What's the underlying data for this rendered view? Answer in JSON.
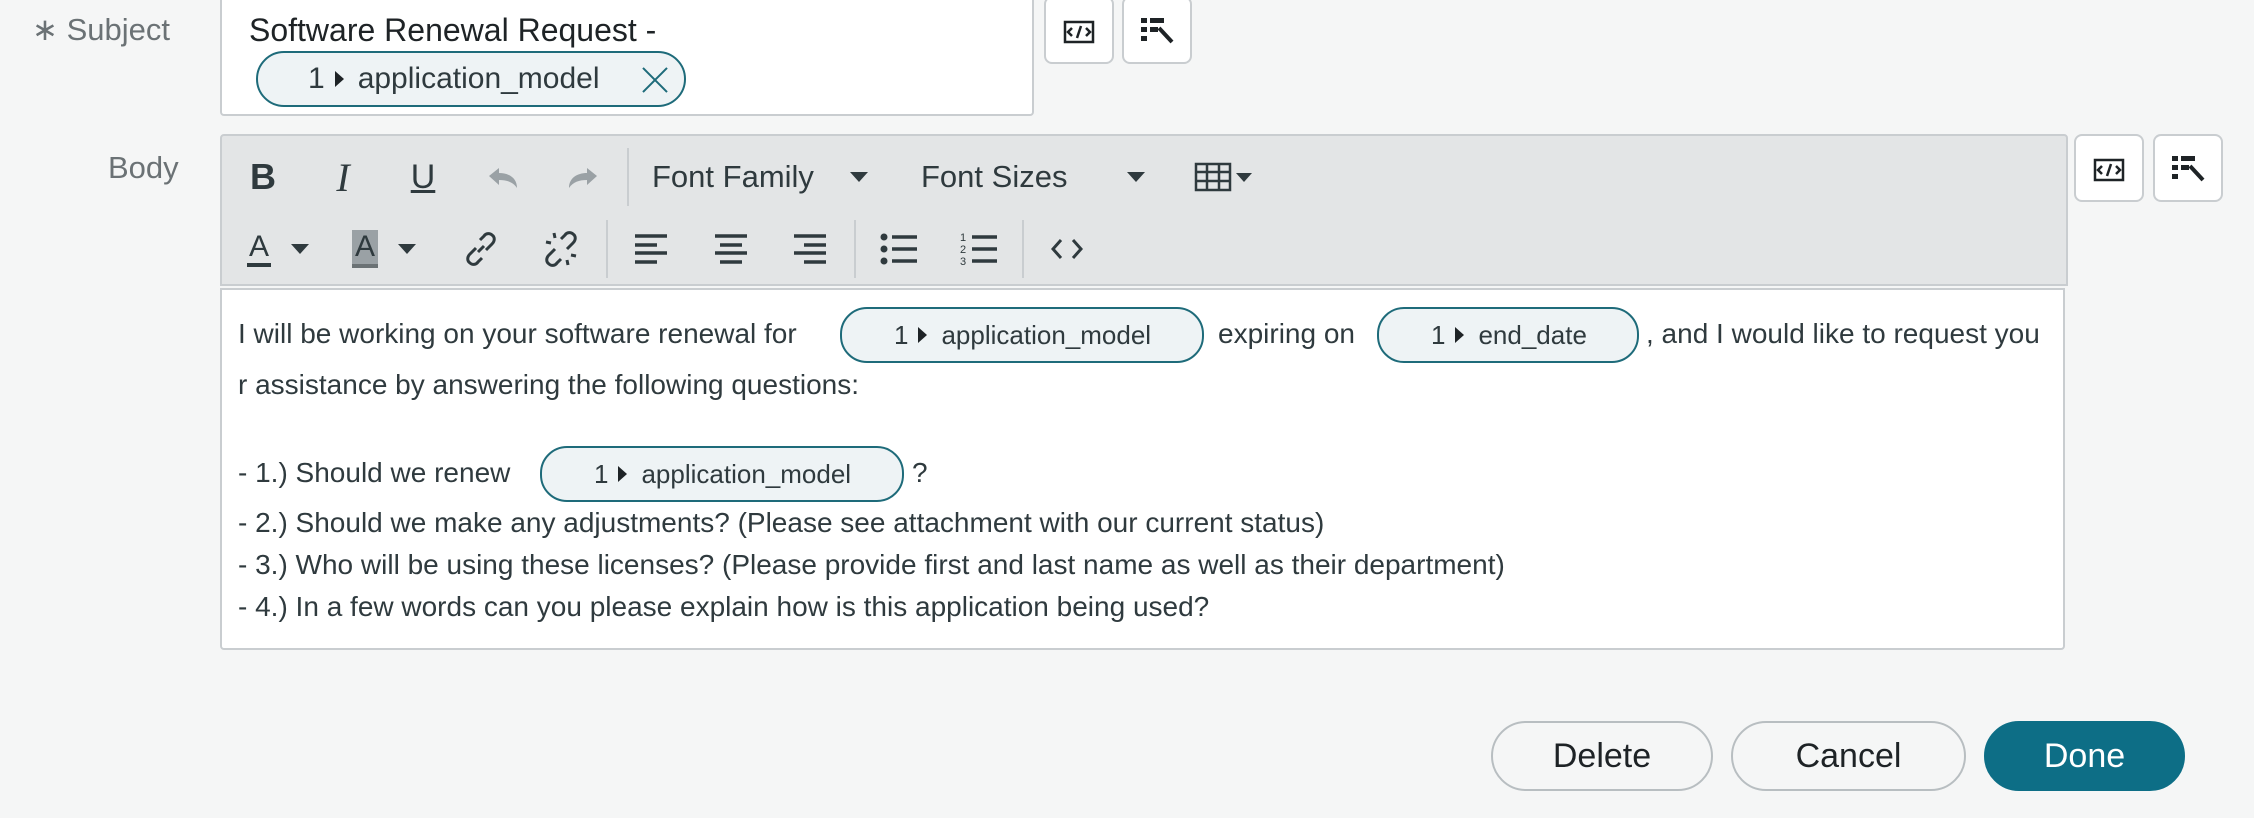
{
  "subject": {
    "label": "Subject",
    "required_marker": "∗",
    "text": "Software Renewal Request -",
    "token": {
      "index": "1",
      "field": "application_model"
    }
  },
  "body": {
    "label": "Body",
    "toolbar": {
      "font_family": "Font Family",
      "font_sizes": "Font Sizes",
      "bold": "B",
      "italic": "I",
      "underline": "U",
      "font_color": "A",
      "highlight_color": "A"
    },
    "content": {
      "line1_prefix": "I will be working on your software renewal for",
      "token1": {
        "index": "1",
        "field": "application_model"
      },
      "line1_mid": "expiring on",
      "token2": {
        "index": "1",
        "field": "end_date"
      },
      "line1_suffix": ", and I would like to request you",
      "line2": "r assistance by answering the following questions:",
      "q1_prefix": "- 1.) Should we renew",
      "token3": {
        "index": "1",
        "field": "application_model"
      },
      "q1_suffix": "?",
      "q2": "- 2.) Should we make any adjustments? (Please see attachment with our current status)",
      "q3": "- 3.) Who will be using these licenses? (Please provide first and last name as well as their department)",
      "q4": "- 4.) In a few words can you please explain how is this application being used?"
    }
  },
  "actions": {
    "delete": "Delete",
    "cancel": "Cancel",
    "done": "Done"
  },
  "colors": {
    "primary": "#0d6e86",
    "token_border": "#1e6b7a",
    "toolbar_bg": "#e3e5e6"
  }
}
